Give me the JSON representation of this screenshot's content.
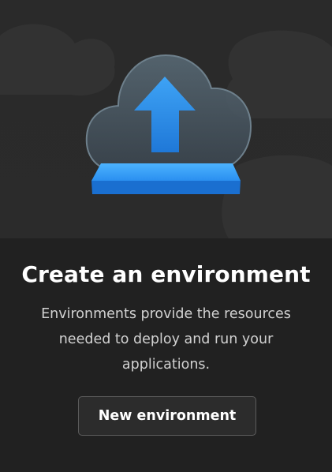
{
  "empty_state": {
    "illustration": "cloud-upload-icon",
    "title": "Create an environment",
    "description": "Environments provide the resources needed to deploy and run your applications.",
    "button_label": "New environment"
  },
  "colors": {
    "background": "#222222",
    "accent": "#2b8fe6",
    "button_border": "#5c5c5c"
  }
}
